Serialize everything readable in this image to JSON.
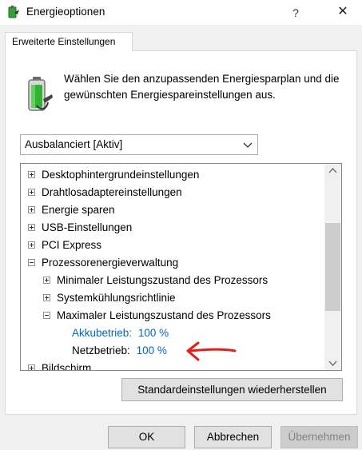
{
  "window": {
    "title": "Energieoptionen",
    "help": "?",
    "close": "✕"
  },
  "tab": {
    "label": "Erweiterte Einstellungen"
  },
  "intro": {
    "text": "Wählen Sie den anzupassenden Energiesparplan und die gewünschten Energiespareinstellungen aus."
  },
  "plan_select": {
    "value": "Ausbalanciert [Aktiv]"
  },
  "tree": {
    "rows": [
      {
        "label": "Desktophintergrundeinstellungen",
        "expander": "plus"
      },
      {
        "label": "Drahtlosadaptereinstellungen",
        "expander": "plus"
      },
      {
        "label": "Energie sparen",
        "expander": "plus"
      },
      {
        "label": "USB-Einstellungen",
        "expander": "plus"
      },
      {
        "label": "PCI Express",
        "expander": "plus"
      },
      {
        "label": "Prozessorenergieverwaltung",
        "expander": "minus"
      },
      {
        "label": "Minimaler Leistungszustand des Prozessors",
        "expander": "plus"
      },
      {
        "label": "Systemkühlungsrichtlinie",
        "expander": "plus"
      },
      {
        "label": "Maximaler Leistungszustand des Prozessors",
        "expander": "minus"
      },
      {
        "label": "Akkubetrieb:",
        "value": "100 %"
      },
      {
        "label": "Netzbetrieb:",
        "value": "100 %"
      },
      {
        "label": "Bildschirm",
        "expander": "plus"
      }
    ]
  },
  "buttons": {
    "restore": "Standardeinstellungen wiederherstellen",
    "ok": "OK",
    "cancel": "Abbrechen",
    "apply": "Übernehmen"
  },
  "colors": {
    "link": "#0066cc",
    "annotation": "#e0201b",
    "battery": "#2ea043"
  }
}
